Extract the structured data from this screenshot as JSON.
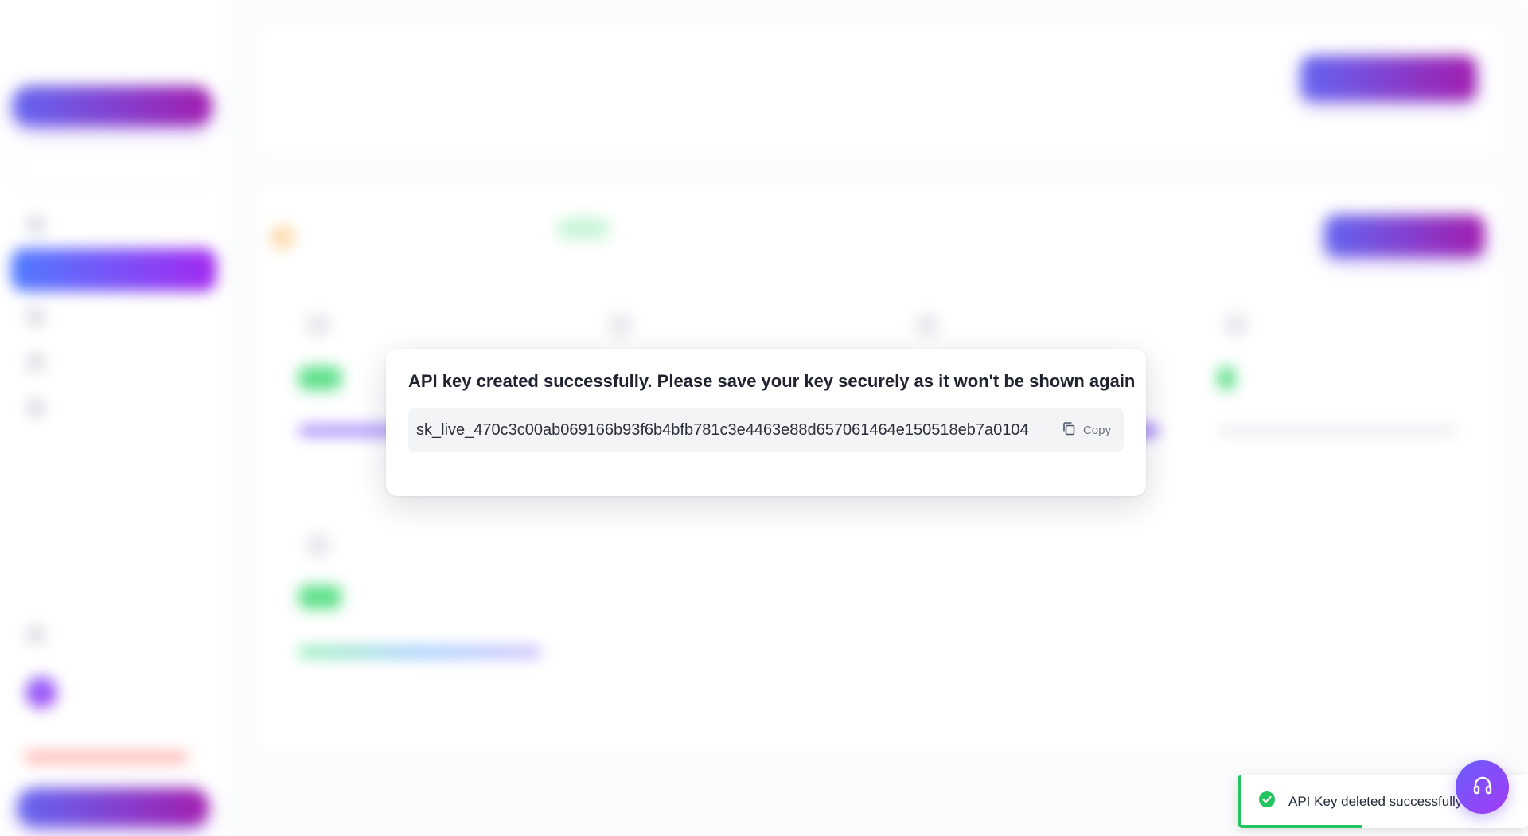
{
  "modal": {
    "message": "API key created successfully. Please save your key securely as it won't be shown again",
    "api_key": "sk_live_470c3c00ab069166b93f6b4bfb781c3e4463e88d657061464e150518eb7a0104",
    "copy_label": "Copy"
  },
  "toast": {
    "message": "API Key deleted successfully",
    "progress_fraction": 0.42,
    "status_color": "#22c55e"
  },
  "support": {
    "icon": "headphones-icon"
  },
  "colors": {
    "accent_start": "#6366f1",
    "accent_end": "#a21caf"
  }
}
